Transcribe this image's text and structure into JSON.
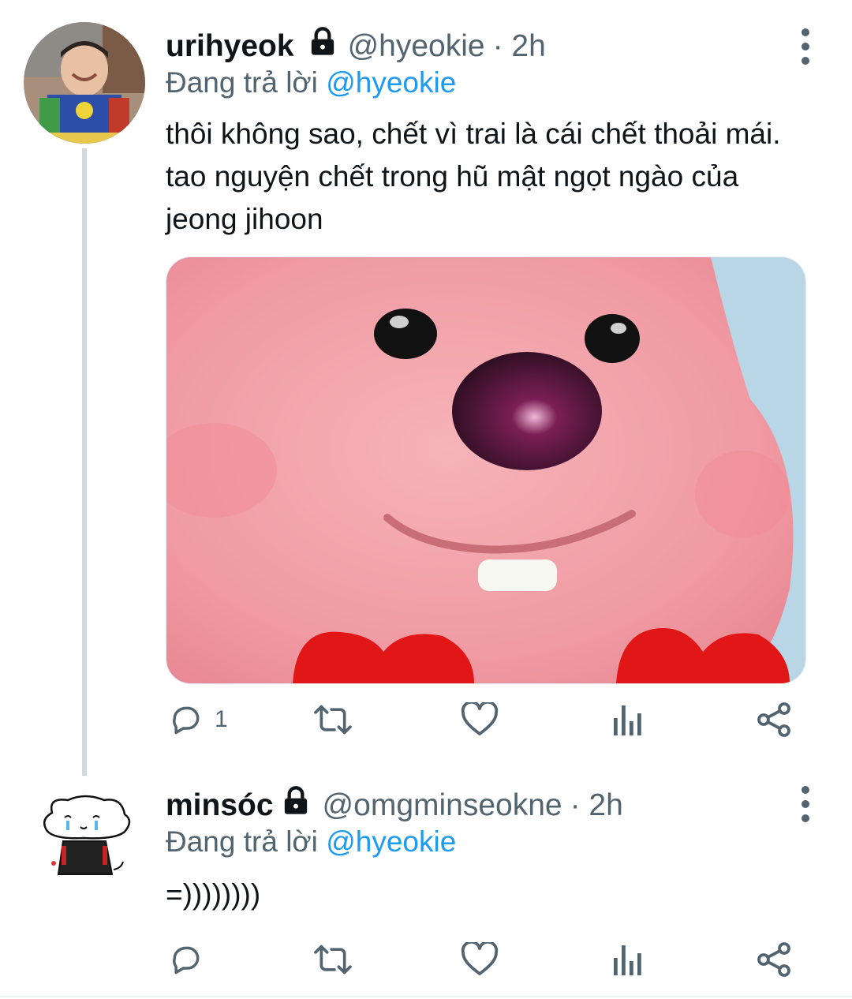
{
  "tweets": [
    {
      "display_name": "urihyeok",
      "handle": "@hyeokie",
      "time": "· 2h",
      "reply_prefix": "Đang trả lời",
      "reply_to": "@hyeokie",
      "text": "thôi không sao, chết vì trai là cái chết thoải mái. tao nguyện chết trong hũ mật ngọt ngào của jeong jihoon",
      "actions": {
        "reply_count": "1"
      }
    },
    {
      "display_name": "minsóc",
      "handle": "@omgminseokne",
      "time": "· 2h",
      "reply_prefix": "Đang trả lời",
      "reply_to": "@hyeokie",
      "text": "=))))))))"
    }
  ],
  "icons": {
    "lock": "lock-icon",
    "more": "more-vertical-icon",
    "reply": "reply-icon",
    "retweet": "retweet-icon",
    "like": "heart-icon",
    "analytics": "analytics-icon",
    "share": "share-icon"
  },
  "colors": {
    "accent": "#1d9bf0",
    "secondary": "#536471",
    "thread_line": "#cfd9de"
  }
}
